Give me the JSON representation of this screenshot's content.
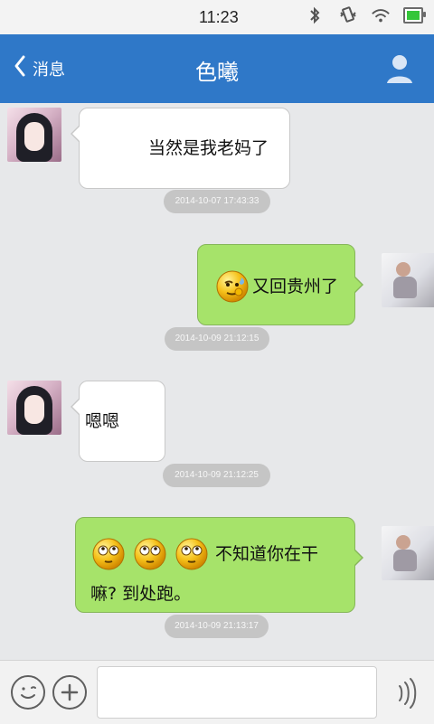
{
  "status": {
    "time": "11:23"
  },
  "nav": {
    "back_label": "消息",
    "title": "色曦"
  },
  "messages": [
    {
      "side": "left",
      "text": "当然是我老妈了",
      "time": "2014-10-07 17:43:33"
    },
    {
      "side": "right",
      "text": "又回贵州了",
      "time": "2014-10-09 21:12:15"
    },
    {
      "side": "left",
      "text": "嗯嗯",
      "time": "2014-10-09 21:12:25"
    },
    {
      "side": "right",
      "text_line1": "不知道你在干",
      "text_line2": "嘛? 到处跑。",
      "time": "2014-10-09 21:13:17"
    }
  ],
  "colors": {
    "nav_bg": "#2f78c8",
    "bubble_right": "#a6e36a",
    "bubble_left": "#ffffff",
    "timestamp_bg": "#c5c5c5"
  },
  "icons": {
    "status": [
      "bluetooth-icon",
      "vibrate-icon",
      "wifi-icon",
      "battery-icon"
    ],
    "nav": [
      "back-icon",
      "profile-icon"
    ],
    "bottom": [
      "emoji-icon",
      "plus-icon",
      "voice-icon"
    ]
  }
}
